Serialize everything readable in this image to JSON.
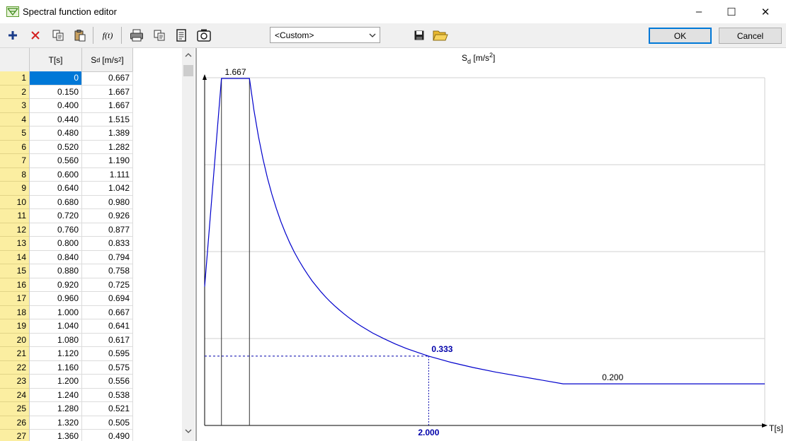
{
  "window": {
    "title": "Spectral function editor",
    "controls": {
      "minimize": "–",
      "maximize": "☐",
      "close": "✕"
    }
  },
  "toolbar": {
    "icons": [
      "add-row-icon",
      "delete-row-icon",
      "copy-icon",
      "paste-icon",
      "function-icon",
      "print-icon",
      "copy-chart-icon",
      "report-icon",
      "screenshot-icon",
      "save-icon",
      "open-folder-icon"
    ],
    "function_label": "f(t)",
    "preset_value": "<Custom>",
    "ok_label": "OK",
    "cancel_label": "Cancel"
  },
  "table": {
    "col_t": "T[s]",
    "col_s_main": "S",
    "col_s_sub": "d",
    "col_s_unit": "[m/s",
    "col_s_exp": "2",
    "col_s_close": "]",
    "rows": [
      {
        "n": "1",
        "t": "0",
        "s": "0.667"
      },
      {
        "n": "2",
        "t": "0.150",
        "s": "1.667"
      },
      {
        "n": "3",
        "t": "0.400",
        "s": "1.667"
      },
      {
        "n": "4",
        "t": "0.440",
        "s": "1.515"
      },
      {
        "n": "5",
        "t": "0.480",
        "s": "1.389"
      },
      {
        "n": "6",
        "t": "0.520",
        "s": "1.282"
      },
      {
        "n": "7",
        "t": "0.560",
        "s": "1.190"
      },
      {
        "n": "8",
        "t": "0.600",
        "s": "1.111"
      },
      {
        "n": "9",
        "t": "0.640",
        "s": "1.042"
      },
      {
        "n": "10",
        "t": "0.680",
        "s": "0.980"
      },
      {
        "n": "11",
        "t": "0.720",
        "s": "0.926"
      },
      {
        "n": "12",
        "t": "0.760",
        "s": "0.877"
      },
      {
        "n": "13",
        "t": "0.800",
        "s": "0.833"
      },
      {
        "n": "14",
        "t": "0.840",
        "s": "0.794"
      },
      {
        "n": "15",
        "t": "0.880",
        "s": "0.758"
      },
      {
        "n": "16",
        "t": "0.920",
        "s": "0.725"
      },
      {
        "n": "17",
        "t": "0.960",
        "s": "0.694"
      },
      {
        "n": "18",
        "t": "1.000",
        "s": "0.667"
      },
      {
        "n": "19",
        "t": "1.040",
        "s": "0.641"
      },
      {
        "n": "20",
        "t": "1.080",
        "s": "0.617"
      },
      {
        "n": "21",
        "t": "1.120",
        "s": "0.595"
      },
      {
        "n": "22",
        "t": "1.160",
        "s": "0.575"
      },
      {
        "n": "23",
        "t": "1.200",
        "s": "0.556"
      },
      {
        "n": "24",
        "t": "1.240",
        "s": "0.538"
      },
      {
        "n": "25",
        "t": "1.280",
        "s": "0.521"
      },
      {
        "n": "26",
        "t": "1.320",
        "s": "0.505"
      },
      {
        "n": "27",
        "t": "1.360",
        "s": "0.490"
      }
    ]
  },
  "chart_data": {
    "type": "line",
    "ylabel_main": "S",
    "ylabel_sub": "d",
    "ylabel_unit": " [m/s",
    "ylabel_exp": "2",
    "ylabel_close": "]",
    "xlabel": "T[s]",
    "xlim": [
      0,
      5.0
    ],
    "ylim": [
      0,
      1.667
    ],
    "grid": true,
    "series_color": "#0000cc",
    "x": [
      0,
      0.15,
      0.4,
      0.44,
      0.48,
      0.52,
      0.56,
      0.6,
      0.64,
      0.68,
      0.72,
      0.76,
      0.8,
      0.84,
      0.88,
      0.92,
      0.96,
      1.0,
      1.04,
      1.08,
      1.12,
      1.16,
      1.2,
      1.24,
      1.28,
      1.32,
      1.36,
      1.4,
      1.5,
      1.6,
      1.7,
      1.8,
      1.9,
      2.0,
      2.2,
      2.4,
      2.6,
      3.2,
      4.0,
      5.0
    ],
    "y": [
      0.667,
      1.667,
      1.667,
      1.515,
      1.389,
      1.282,
      1.19,
      1.111,
      1.042,
      0.98,
      0.926,
      0.877,
      0.833,
      0.794,
      0.758,
      0.725,
      0.694,
      0.667,
      0.641,
      0.617,
      0.595,
      0.575,
      0.556,
      0.538,
      0.521,
      0.505,
      0.49,
      0.476,
      0.444,
      0.417,
      0.392,
      0.37,
      0.351,
      0.333,
      0.303,
      0.278,
      0.256,
      0.2,
      0.2,
      0.2
    ],
    "annotations": {
      "peak": {
        "x_start": 0.15,
        "x_end": 0.4,
        "value": 1.667,
        "label": "1.667"
      },
      "marker": {
        "x": 2.0,
        "y": 0.333,
        "x_label": "2.000",
        "y_label": "0.333"
      },
      "tail": {
        "x": 3.2,
        "y": 0.2,
        "label": "0.200"
      }
    }
  }
}
